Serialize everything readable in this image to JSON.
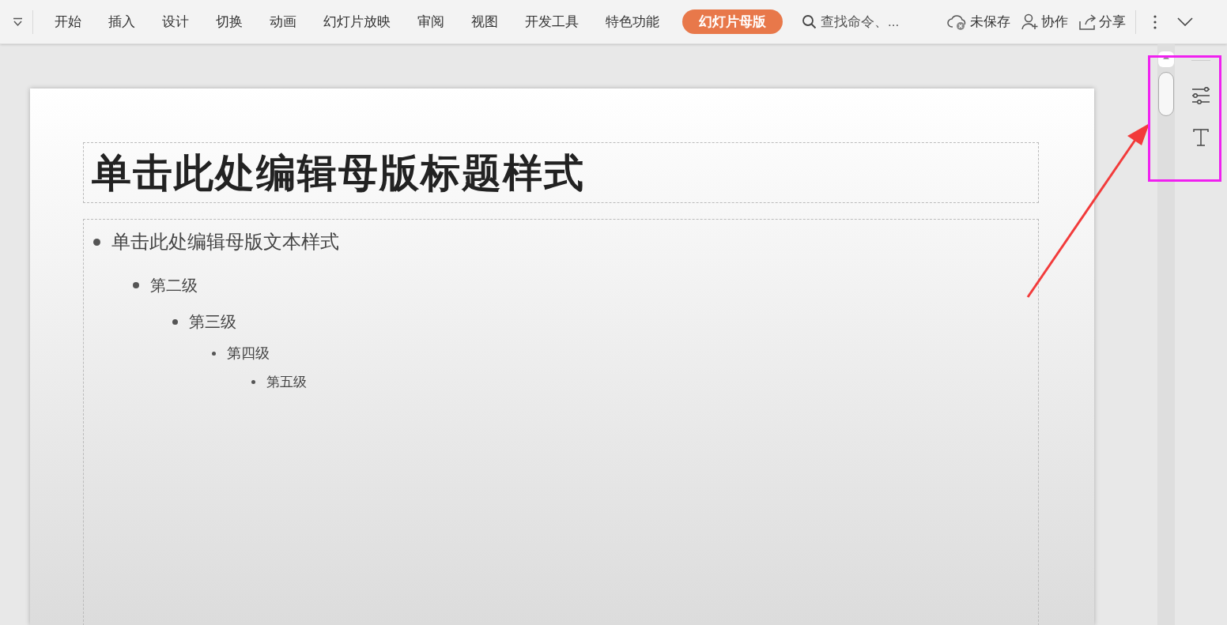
{
  "ribbon": {
    "tabs": [
      {
        "label": "开始",
        "selected": false
      },
      {
        "label": "插入",
        "selected": false
      },
      {
        "label": "设计",
        "selected": false
      },
      {
        "label": "切换",
        "selected": false
      },
      {
        "label": "动画",
        "selected": false
      },
      {
        "label": "幻灯片放映",
        "selected": false
      },
      {
        "label": "审阅",
        "selected": false
      },
      {
        "label": "视图",
        "selected": false
      },
      {
        "label": "开发工具",
        "selected": false
      },
      {
        "label": "特色功能",
        "selected": false
      },
      {
        "label": "幻灯片母版",
        "selected": true
      }
    ],
    "search": {
      "placeholder": "查找命令、..."
    },
    "actions": [
      {
        "kind": "cloud",
        "label": "未保存"
      },
      {
        "kind": "collab",
        "label": "协作"
      },
      {
        "kind": "share",
        "label": "分享"
      }
    ]
  },
  "slide": {
    "title": "单击此处编辑母版标题样式",
    "outline": [
      {
        "text": "单击此处编辑母版文本样式",
        "children": [
          {
            "text": "第二级",
            "children": [
              {
                "text": "第三级",
                "children": [
                  {
                    "text": "第四级",
                    "children": [
                      {
                        "text": "第五级"
                      }
                    ]
                  }
                ]
              }
            ]
          }
        ]
      }
    ]
  }
}
